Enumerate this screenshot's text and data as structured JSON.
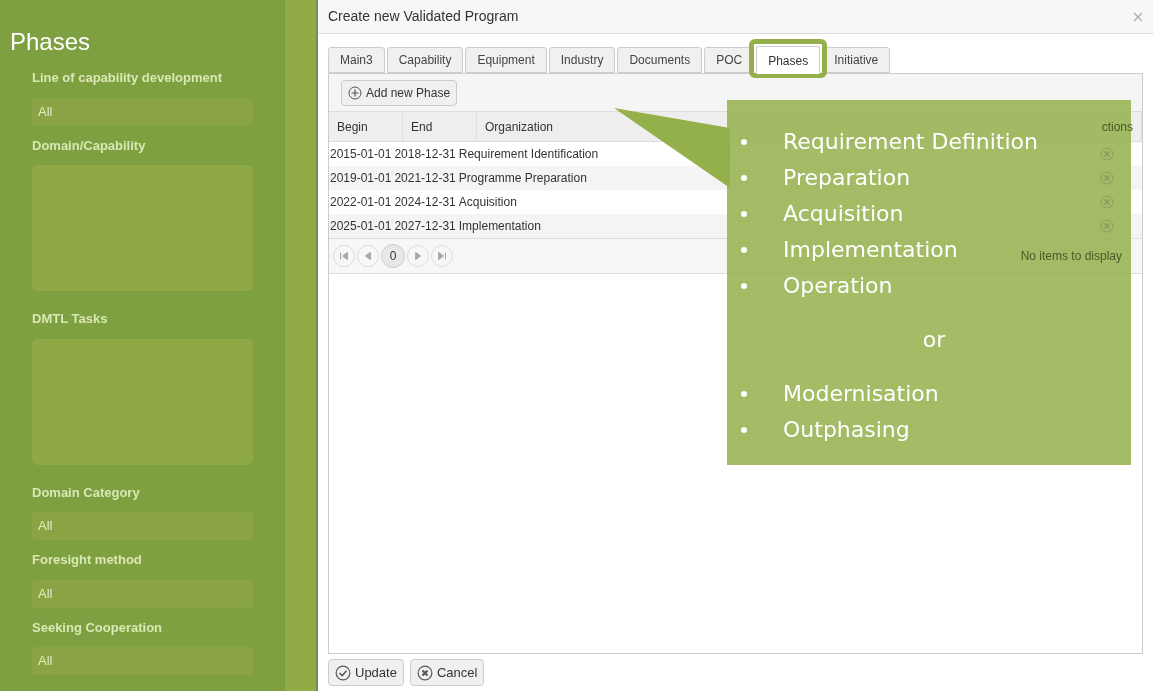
{
  "sidebar": {
    "title": "Phases",
    "filters": [
      {
        "label": "Line of capability development",
        "kind": "select",
        "value": "All"
      },
      {
        "label": "Domain/Capability",
        "kind": "tree"
      },
      {
        "label": "DMTL Tasks",
        "kind": "tree"
      },
      {
        "label": "Domain Category",
        "kind": "select",
        "value": "All"
      },
      {
        "label": "Foresight method",
        "kind": "select",
        "value": "All"
      },
      {
        "label": "Seeking Cooperation",
        "kind": "select",
        "value": "All"
      }
    ]
  },
  "dialog": {
    "title": "Create new Validated Program",
    "tabs": [
      {
        "label": "Main3",
        "selected": false
      },
      {
        "label": "Capability",
        "selected": false
      },
      {
        "label": "Equipment",
        "selected": false
      },
      {
        "label": "Industry",
        "selected": false
      },
      {
        "label": "Documents",
        "selected": false
      },
      {
        "label": "POC",
        "selected": false
      },
      {
        "label": "Phases",
        "selected": true
      },
      {
        "label": "Initiative",
        "selected": false
      }
    ],
    "add_button": "Add new Phase",
    "table": {
      "columns": [
        "Begin",
        "End",
        "Organization",
        "ctions"
      ],
      "rows": [
        [
          "2015-01-01",
          "2018-12-31",
          "Requirement Identification"
        ],
        [
          "2019-01-01",
          "2021-12-31",
          "Programme Preparation"
        ],
        [
          "2022-01-01",
          "2024-12-31",
          "Acquisition"
        ],
        [
          "2025-01-01",
          "2027-12-31",
          "Implementation"
        ]
      ]
    },
    "pager": {
      "page": "0"
    },
    "empty_message": "No items to display",
    "buttons": [
      {
        "label": "Update",
        "kind": "update"
      },
      {
        "label": "Cancel",
        "kind": "cancel"
      }
    ]
  },
  "callout": {
    "list_1": [
      "Requirement Definition",
      "Preparation",
      "Acquisition",
      "Implementation",
      "Operation"
    ],
    "separator": "or",
    "list_2": [
      "Modernisation",
      "Outphasing"
    ]
  }
}
